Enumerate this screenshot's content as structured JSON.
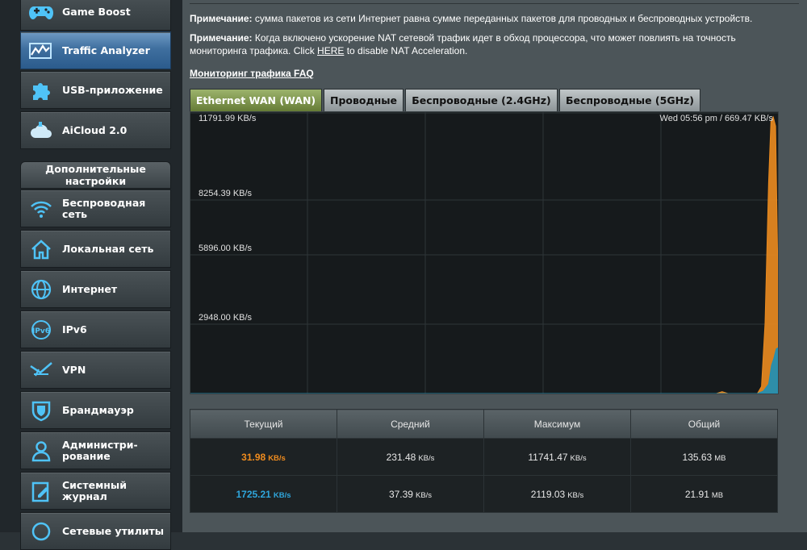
{
  "sidebar": {
    "items": [
      {
        "label": "Game Boost",
        "icon": "gamepad-icon"
      },
      {
        "label": "Traffic Analyzer",
        "icon": "traffic-analyzer-icon",
        "active": true
      },
      {
        "label": "USB-приложение",
        "icon": "puzzle-icon"
      },
      {
        "label": "AiCloud 2.0",
        "icon": "cloud-icon"
      }
    ],
    "advanced_header": "Дополнительные\nнастройки",
    "advanced_items": [
      {
        "label": "Беспроводная\nсеть",
        "icon": "wifi-icon"
      },
      {
        "label": "Локальная сеть",
        "icon": "home-icon"
      },
      {
        "label": "Интернет",
        "icon": "globe-icon"
      },
      {
        "label": "IPv6",
        "icon": "ipv6-icon"
      },
      {
        "label": "VPN",
        "icon": "vpn-icon"
      },
      {
        "label": "Брандмауэр",
        "icon": "shield-icon"
      },
      {
        "label": "Администри-\nрование",
        "icon": "admin-user-icon"
      },
      {
        "label": "Системный\nжурнал",
        "icon": "log-edit-icon"
      },
      {
        "label": "Сетевые утилиты",
        "icon": "network-tools-icon"
      }
    ]
  },
  "notes": {
    "note1_prefix": "Примечание:",
    "note1_text": " сумма пакетов из сети Интернет равна сумме переданных пакетов для проводных и беспроводных устройств.",
    "note2_prefix": "Примечание:",
    "note2_text_a": " Когда включено ускорение NAT сетевой трафик идет в обход процессора, что может повлиять на точность",
    "note2_text_b": "мониторинга трафика. Click ",
    "note2_link": "HERE",
    "note2_text_c": " to disable NAT Acceleration.",
    "faq_link": "Мониторинг трафика FAQ"
  },
  "tabs": [
    {
      "label": "Ethernet WAN (WAN)",
      "active": true
    },
    {
      "label": "Проводные"
    },
    {
      "label": "Беспроводные (2.4GHz)"
    },
    {
      "label": "Беспроводные (5GHz)"
    }
  ],
  "chart_data": {
    "type": "area",
    "y_tick_labels": [
      "11791.99 KB/s",
      "8254.39 KB/s",
      "5896.00 KB/s",
      "2948.00 KB/s"
    ],
    "ylim": [
      0,
      11791.99
    ],
    "status_label": "Wed 05:56 pm / 669.47 KB/s",
    "grid": true,
    "series": [
      {
        "color": "#e8891f",
        "points": [
          [
            0.0,
            0
          ],
          [
            0.895,
            0
          ],
          [
            0.905,
            80
          ],
          [
            0.915,
            0
          ],
          [
            0.965,
            0
          ],
          [
            0.972,
            300
          ],
          [
            0.978,
            3000
          ],
          [
            0.984,
            9000
          ],
          [
            0.988,
            11600
          ],
          [
            0.992,
            11791.99
          ],
          [
            0.996,
            11400
          ],
          [
            1.0,
            5000
          ]
        ]
      },
      {
        "color": "#1f8fb5",
        "points": [
          [
            0.0,
            0
          ],
          [
            0.965,
            0
          ],
          [
            0.975,
            100
          ],
          [
            0.984,
            400
          ],
          [
            0.989,
            1200
          ],
          [
            0.993,
            1500
          ],
          [
            0.997,
            1900
          ],
          [
            1.0,
            1950
          ]
        ]
      }
    ],
    "colors": {
      "received": "#e8891f",
      "transmitted": "#1f8fb5",
      "grid": "#2e3538"
    }
  },
  "stats": {
    "headers": [
      "Текущий",
      "Средний",
      "Максимум",
      "Общий"
    ],
    "rows": [
      {
        "current": "31.98",
        "current_unit": "KB/s",
        "avg": "231.48",
        "avg_unit": "KB/s",
        "max": "11741.47",
        "max_unit": "KB/s",
        "total": "135.63",
        "total_unit": "MB"
      },
      {
        "current": "1725.21",
        "current_unit": "KB/s",
        "avg": "37.39",
        "avg_unit": "KB/s",
        "max": "2119.03",
        "max_unit": "KB/s",
        "total": "21.91",
        "total_unit": "MB"
      }
    ]
  }
}
